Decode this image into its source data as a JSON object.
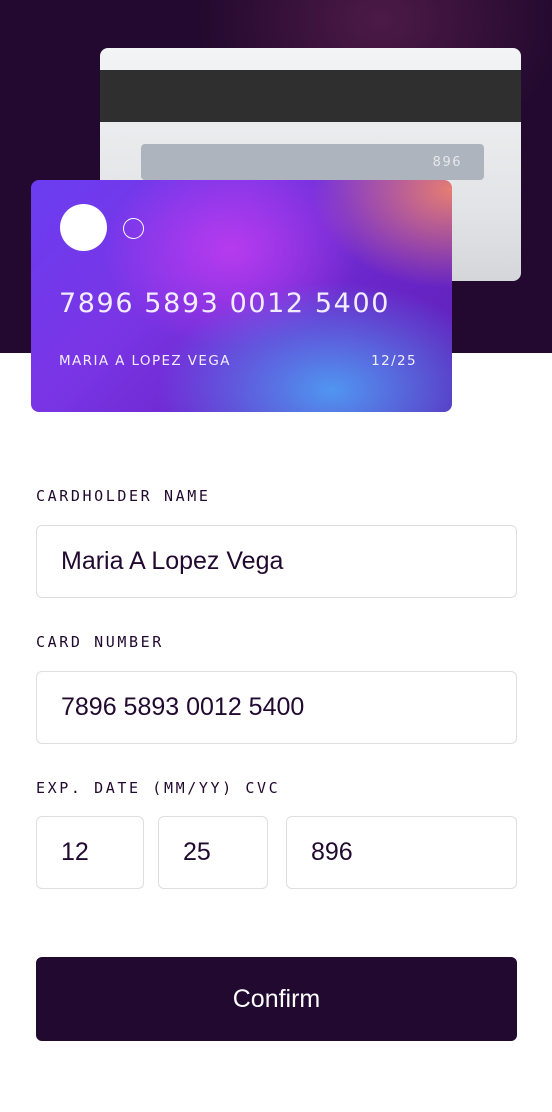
{
  "card": {
    "back": {
      "cvc": "896"
    },
    "front": {
      "number": "7896 5893 0012 5400",
      "holder": "MARIA A LOPEZ VEGA",
      "expiry": "12/25"
    }
  },
  "form": {
    "cardholder_label": "CARDHOLDER NAME",
    "cardholder_value": "Maria A Lopez Vega",
    "number_label": "CARD NUMBER",
    "number_value": "7896 5893 0012 5400",
    "exp_cvc_label": "EXP. DATE (MM/YY) CVC",
    "exp_month": "12",
    "exp_year": "25",
    "cvc": "896",
    "confirm_label": "Confirm"
  },
  "colors": {
    "hero_bg": "#23092f",
    "accent_dark": "#21092f",
    "input_border": "#dedddf"
  }
}
